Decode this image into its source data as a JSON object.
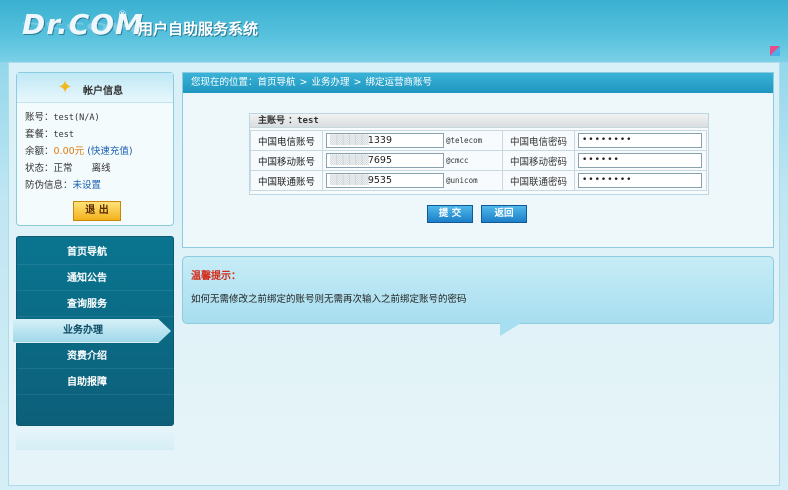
{
  "header": {
    "logo": "Dr.COM",
    "registered": "®",
    "title": "用户自助服务系统"
  },
  "account": {
    "title": "帐户信息",
    "account_label": "账号：",
    "account_value": "test(N/A)",
    "plan_label": "套餐：",
    "plan_value": "test",
    "balance_label": "余额：",
    "balance_value": "0.00元",
    "recharge": "(快速充值)",
    "status_label": "状态：",
    "status_value": "正常",
    "online_value": "离线",
    "security_label": "防伪信息：",
    "security_value": "未设置",
    "logout": "退  出"
  },
  "menu": {
    "items": [
      {
        "label": "首页导航"
      },
      {
        "label": "通知公告"
      },
      {
        "label": "查询服务"
      },
      {
        "label": "业务办理"
      },
      {
        "label": "资费介绍"
      },
      {
        "label": "自助报障"
      }
    ],
    "active_index": 3
  },
  "breadcrumb": {
    "prefix": "您现在的位置：",
    "items": [
      "首页导航",
      "业务办理",
      "绑定运营商账号"
    ],
    "separator": ">"
  },
  "form": {
    "main_account_label": "主账号 ：",
    "main_account_value": "test",
    "rows": [
      {
        "label": "中国电信账号",
        "value_tail": "1339",
        "suffix": "@telecom",
        "pwd_label": "中国电信密码",
        "pwd": "••••••••"
      },
      {
        "label": "中国移动账号",
        "value_tail": "7695",
        "suffix": "@cmcc",
        "pwd_label": "中国移动密码",
        "pwd": "••••••"
      },
      {
        "label": "中国联通账号",
        "value_tail": "9535",
        "suffix": "@unicom",
        "pwd_label": "中国联通密码",
        "pwd": "••••••••"
      }
    ],
    "submit": "提 交",
    "back": "返回"
  },
  "tip": {
    "title": "温馨提示：",
    "text": "如何无需修改之前绑定的账号则无需再次输入之前绑定账号的密码"
  }
}
